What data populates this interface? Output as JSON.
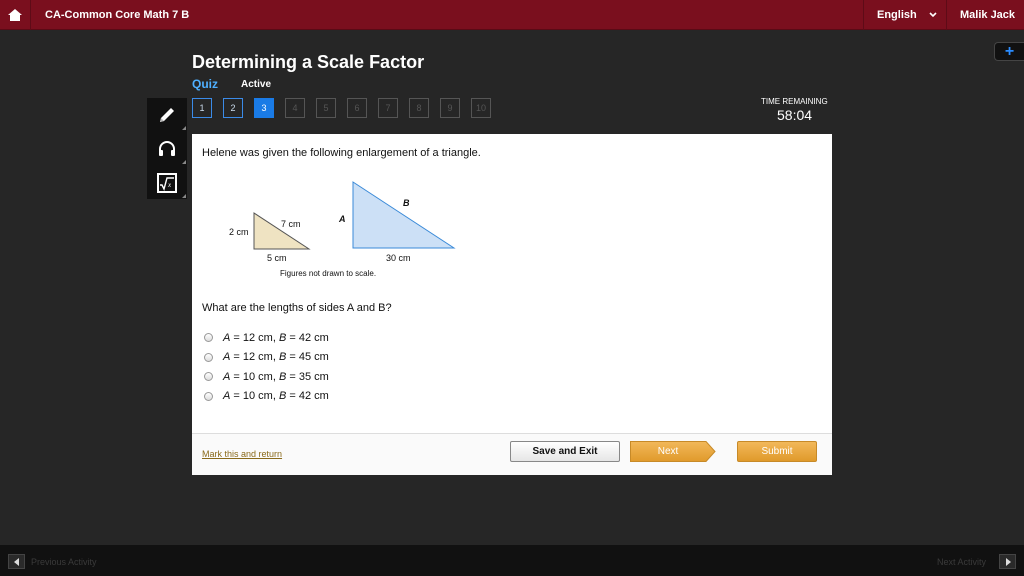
{
  "header": {
    "course_title": "CA-Common Core Math 7 B",
    "language": "English",
    "user_name": "Malik Jack",
    "plus_label": "+"
  },
  "page": {
    "title": "Determining a Scale Factor",
    "quiz_label": "Quiz",
    "status": "Active"
  },
  "question_nav": [
    {
      "label": "1",
      "state": "done"
    },
    {
      "label": "2",
      "state": "done"
    },
    {
      "label": "3",
      "state": "current"
    },
    {
      "label": "4",
      "state": "todo"
    },
    {
      "label": "5",
      "state": "todo"
    },
    {
      "label": "6",
      "state": "todo"
    },
    {
      "label": "7",
      "state": "todo"
    },
    {
      "label": "8",
      "state": "todo"
    },
    {
      "label": "9",
      "state": "todo"
    },
    {
      "label": "10",
      "state": "todo"
    }
  ],
  "timer": {
    "label": "TIME REMAINING",
    "value": "58:04"
  },
  "tools": [
    "pencil-icon",
    "headphones-icon",
    "calculator-icon"
  ],
  "question": {
    "prompt": "Helene was given the following enlargement of a triangle.",
    "small_triangle": {
      "left_side": "2 cm",
      "hypotenuse": "7 cm",
      "bottom": "5 cm"
    },
    "large_triangle": {
      "left_side": "A",
      "hypotenuse": "B",
      "bottom": "30 cm"
    },
    "figure_note": "Figures not drawn to scale.",
    "ask": "What are the lengths of sides A and B?",
    "options": [
      {
        "a": "12 cm",
        "b": "42 cm"
      },
      {
        "a": "12 cm",
        "b": "45 cm"
      },
      {
        "a": "10 cm",
        "b": "35 cm"
      },
      {
        "a": "10 cm",
        "b": "42 cm"
      }
    ]
  },
  "footer": {
    "mark_link": "Mark this and return",
    "save_exit": "Save and Exit",
    "next": "Next",
    "submit": "Submit"
  },
  "bottom_nav": {
    "previous": "Previous Activity",
    "next": "Next Activity"
  },
  "colors": {
    "topbar": "#7a0f1e",
    "accent_blue": "#1a7be6",
    "button_orange": "#e8a43c"
  }
}
